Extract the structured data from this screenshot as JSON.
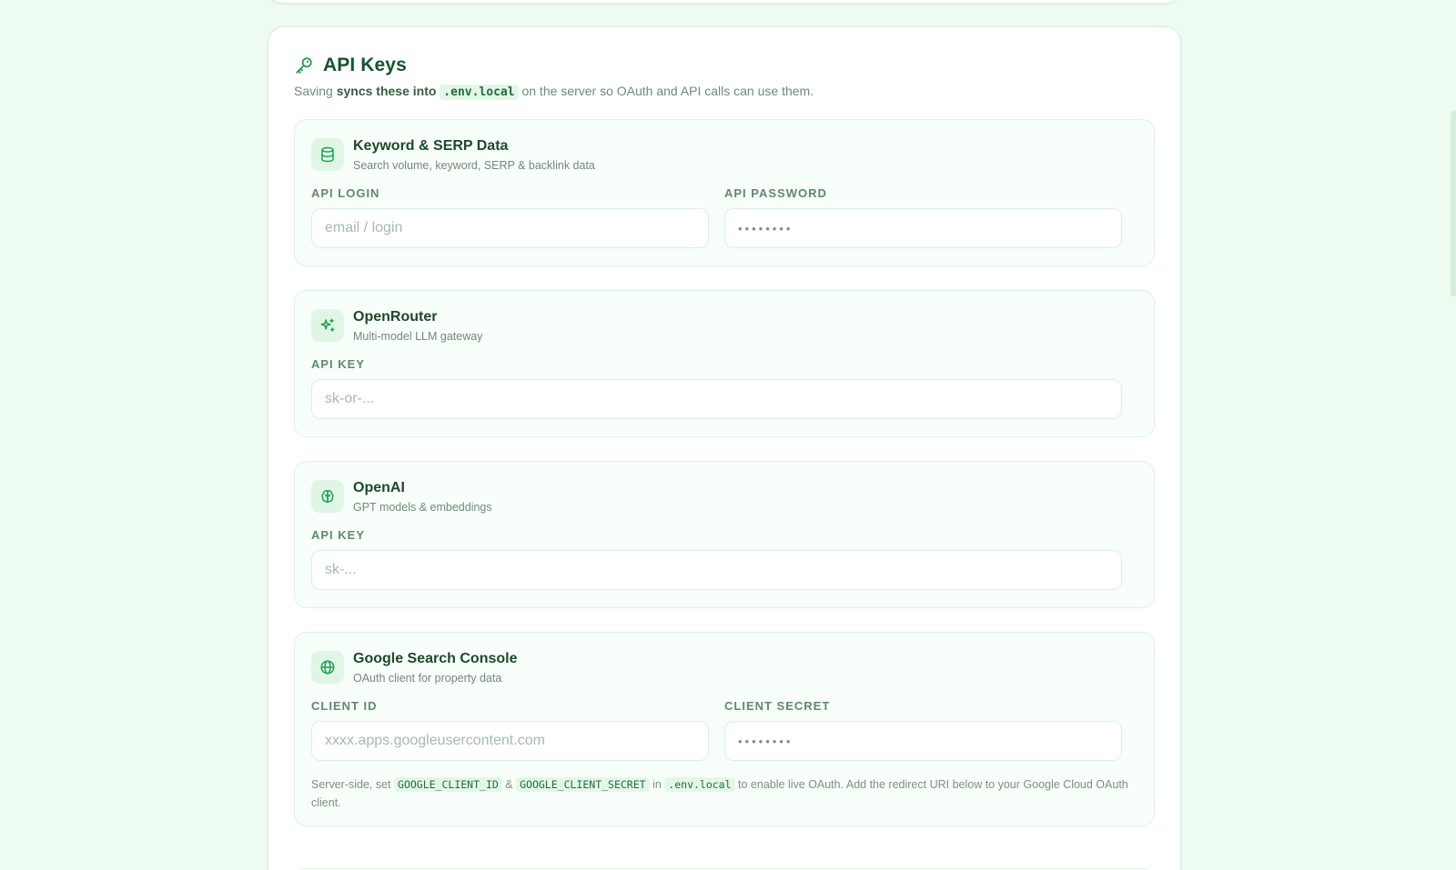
{
  "header": {
    "title": "API Keys",
    "icon": "key-icon",
    "intro_prefix": "Saving",
    "intro_bold": "syncs these into",
    "intro_code": ".env.local",
    "intro_suffix": "on the server so OAuth and API calls can use them."
  },
  "sections": [
    {
      "icon": "database-icon",
      "title": "Keyword & SERP Data",
      "subtitle": "Search volume, keyword, SERP & backlink data",
      "fields": [
        {
          "label": "API LOGIN",
          "placeholder": "email / login",
          "value": ""
        },
        {
          "label": "API PASSWORD",
          "placeholder": "••••••••",
          "value": ""
        }
      ]
    },
    {
      "icon": "sparkles-icon",
      "title": "OpenRouter",
      "subtitle": "Multi-model LLM gateway",
      "fields": [
        {
          "label": "API KEY",
          "placeholder": "sk-or-...",
          "value": ""
        }
      ]
    },
    {
      "icon": "brain-icon",
      "title": "OpenAI",
      "subtitle": "GPT models & embeddings",
      "fields": [
        {
          "label": "API KEY",
          "placeholder": "sk-...",
          "value": ""
        }
      ]
    },
    {
      "icon": "globe-icon",
      "title": "Google Search Console",
      "subtitle": "OAuth client for property data",
      "fields": [
        {
          "label": "CLIENT ID",
          "placeholder": "xxxx.apps.googleusercontent.com",
          "value": ""
        },
        {
          "label": "CLIENT SECRET",
          "placeholder": "••••••••",
          "value": ""
        }
      ],
      "note": {
        "t1": "Server-side, set",
        "c1": "GOOGLE_CLIENT_ID",
        "t2": "&",
        "c2": "GOOGLE_CLIENT_SECRET",
        "t3": "in",
        "c3": ".env.local",
        "t4": "to enable live OAuth. Add the redirect URI below to your Google Cloud OAuth client."
      }
    }
  ],
  "colors": {
    "page_bg": "#eefbf1",
    "accent": "#22a150",
    "title": "#14552f"
  }
}
